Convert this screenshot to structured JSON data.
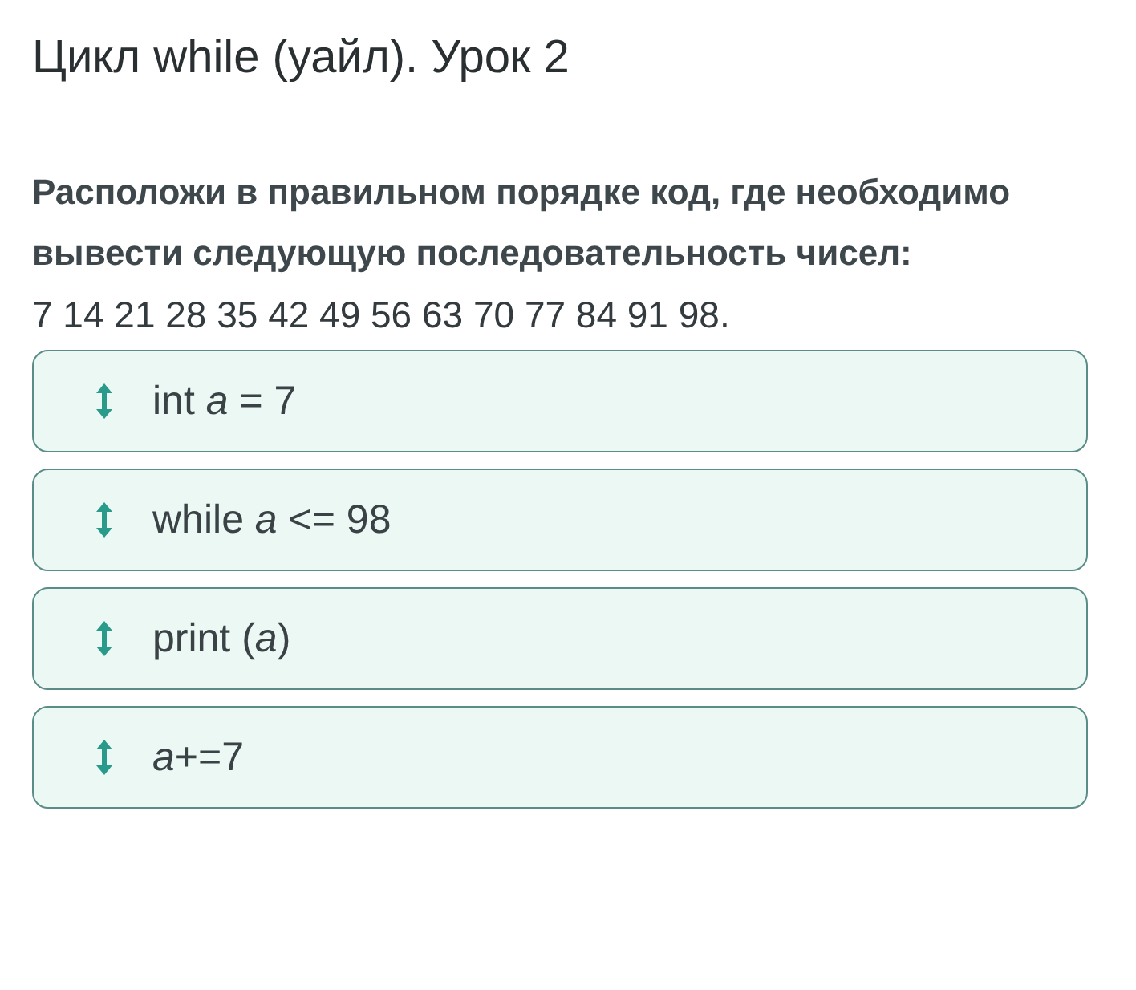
{
  "title": "Цикл while (уайл). Урок 2",
  "question": "Расположи в правильном порядке код, где необходимо вывести следующую последовательность чисел:",
  "sequence": "7 14 21 28 35 42 49 56 63 70 77 84 91 98.",
  "items": [
    {
      "code": "int *a* = 7"
    },
    {
      "code": "while *a* <= 98"
    },
    {
      "code": "print (*a*)"
    },
    {
      "code": "*a*+=7"
    }
  ]
}
